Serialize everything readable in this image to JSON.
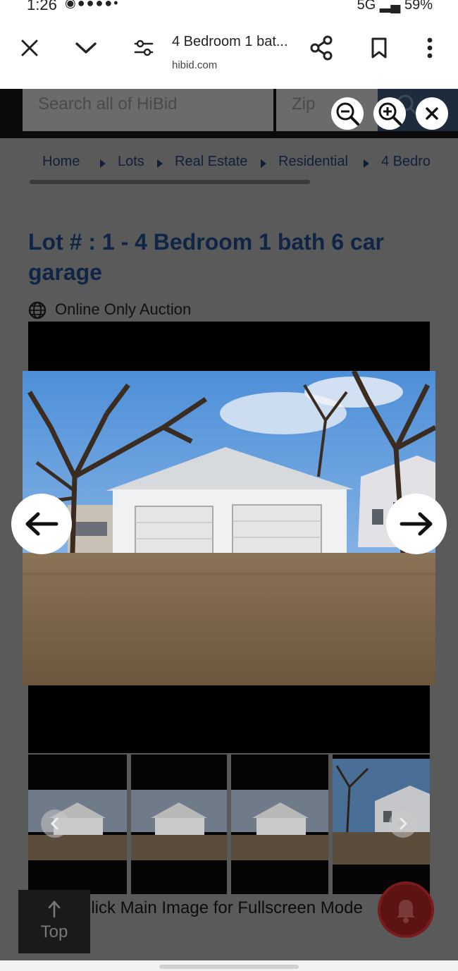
{
  "status_bar": {
    "time": "1:26",
    "notification_icons": [
      "messenger-icon",
      "chat-icon",
      "facebook-icon",
      "facebook-icon",
      "facebook-icon",
      "dot-icon"
    ],
    "network": "5G",
    "battery": "59%"
  },
  "browser": {
    "tab_title": "4 Bedroom 1 bat...",
    "domain": "hibid.com",
    "icons": [
      "close-icon",
      "chevron-down-icon",
      "settings-sliders-icon",
      "share-icon",
      "bookmark-icon",
      "more-vert-icon"
    ]
  },
  "site_header": {
    "search_placeholder": "Search all of HiBid",
    "zip_placeholder": "Zip"
  },
  "zoom_controls": [
    "zoom-out-icon",
    "zoom-in-icon",
    "close-icon"
  ],
  "breadcrumb": [
    "Home",
    "Lots",
    "Real Estate",
    "Residential",
    "4 Bedro"
  ],
  "lot": {
    "title": "Lot # : 1 - 4 Bedroom 1 bath 6 car garage",
    "auction_type": "Online Only Auction"
  },
  "gallery": {
    "thumbnail_count": 4,
    "fullscreen_hint": "Click Main Image for Fullscreen Mode"
  },
  "top_button": {
    "label": "Top"
  },
  "colors": {
    "overlay": "#5a5a5a",
    "title_navy": "#0f2545",
    "alert_red": "#5d1314"
  }
}
